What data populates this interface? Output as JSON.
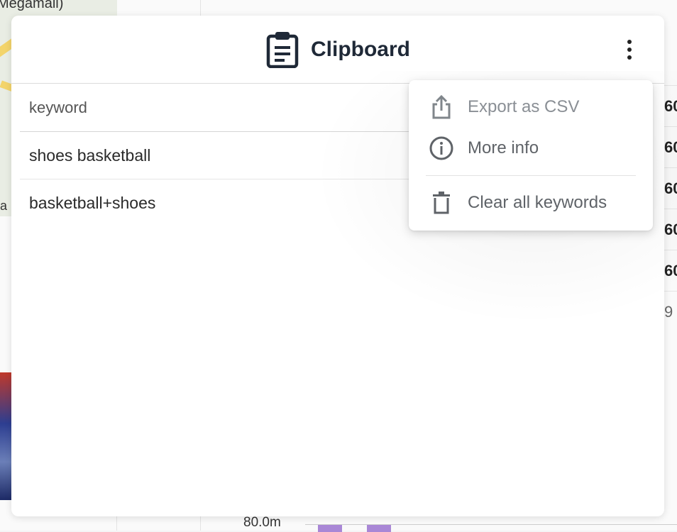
{
  "background": {
    "map_label": "Megamall)",
    "map_fragment": "a",
    "axis_label": "80.0m",
    "right_column": [
      "60",
      "60",
      "60",
      "60",
      "60",
      "9"
    ]
  },
  "clipboard": {
    "title": "Clipboard",
    "title_icon": "clipboard-icon",
    "menu_icon": "more-vert-icon",
    "table": {
      "header": "keyword",
      "rows": [
        "shoes basketball",
        "basketball+shoes"
      ]
    }
  },
  "menu": {
    "items": [
      {
        "label": "Export as CSV",
        "icon": "share-export-icon",
        "enabled": false
      },
      {
        "label": "More info",
        "icon": "info-icon",
        "enabled": true
      },
      {
        "label": "Clear all keywords",
        "icon": "trash-icon",
        "enabled": true
      }
    ]
  },
  "colors": {
    "title": "#1f2937",
    "menu_text": "#5f6368",
    "chart_bar": "#a987d6"
  }
}
